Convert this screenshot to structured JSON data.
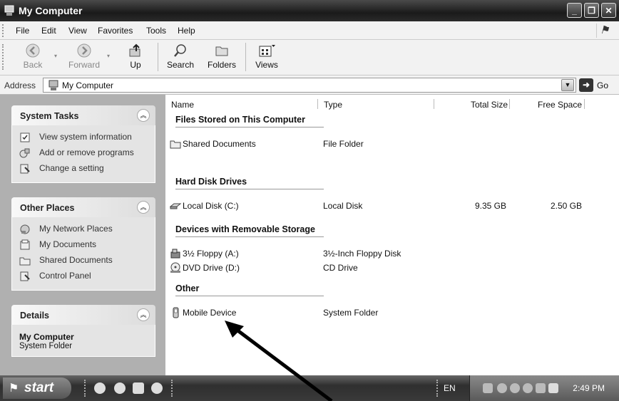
{
  "window": {
    "title": "My Computer"
  },
  "menu": [
    "File",
    "Edit",
    "View",
    "Favorites",
    "Tools",
    "Help"
  ],
  "toolbar": {
    "back": "Back",
    "forward": "Forward",
    "up": "Up",
    "search": "Search",
    "folders": "Folders",
    "views": "Views"
  },
  "address": {
    "label": "Address",
    "value": "My Computer",
    "go": "Go"
  },
  "left_pane": {
    "system_tasks": {
      "title": "System Tasks",
      "items": [
        {
          "label": "View system information",
          "icon": "system-info-icon"
        },
        {
          "label": "Add or remove programs",
          "icon": "add-remove-icon"
        },
        {
          "label": "Change a setting",
          "icon": "control-panel-icon"
        }
      ]
    },
    "other_places": {
      "title": "Other Places",
      "items": [
        {
          "label": "My Network Places",
          "icon": "network-icon"
        },
        {
          "label": "My Documents",
          "icon": "documents-icon"
        },
        {
          "label": "Shared Documents",
          "icon": "folder-icon"
        },
        {
          "label": "Control Panel",
          "icon": "control-panel-icon"
        }
      ]
    },
    "details": {
      "title": "Details",
      "name": "My Computer",
      "subtitle": "System Folder"
    }
  },
  "columns": {
    "name": "Name",
    "type": "Type",
    "total_size": "Total Size",
    "free_space": "Free Space"
  },
  "groups": [
    {
      "title": "Files Stored on This Computer",
      "items": [
        {
          "name": "Shared Documents",
          "type": "File Folder",
          "total": "",
          "free": "",
          "icon": "folder-icon"
        }
      ]
    },
    {
      "title": "Hard Disk Drives",
      "items": [
        {
          "name": "Local Disk (C:)",
          "type": "Local Disk",
          "total": "9.35 GB",
          "free": "2.50 GB",
          "icon": "hard-disk-icon"
        }
      ]
    },
    {
      "title": "Devices with Removable Storage",
      "items": [
        {
          "name": "3½ Floppy (A:)",
          "type": "3½-Inch Floppy Disk",
          "total": "",
          "free": "",
          "icon": "floppy-icon"
        },
        {
          "name": "DVD Drive (D:)",
          "type": "CD Drive",
          "total": "",
          "free": "",
          "icon": "dvd-icon"
        }
      ]
    },
    {
      "title": "Other",
      "items": [
        {
          "name": "Mobile Device",
          "type": "System Folder",
          "total": "",
          "free": "",
          "icon": "mobile-device-icon"
        }
      ]
    }
  ],
  "taskbar": {
    "start": "start",
    "lang": "EN",
    "clock": "2:49 PM"
  }
}
